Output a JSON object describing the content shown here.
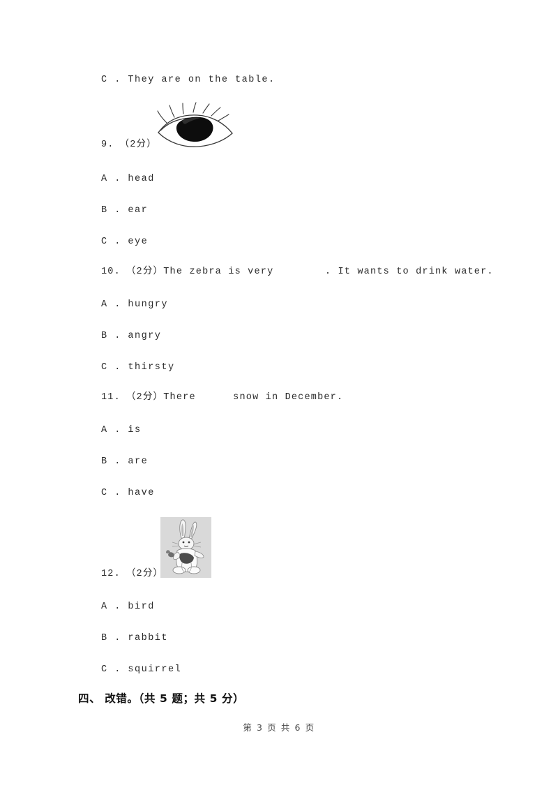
{
  "page": {
    "footer_text": "第 3 页 共 6 页",
    "page_number": 3,
    "total_pages": 6,
    "background_color": "#ffffff",
    "text_color": "#2a2a2a"
  },
  "content": {
    "carryover_option": "C . They are on the table.",
    "questions": [
      {
        "number": "9.",
        "marks": "（2分）",
        "prompt": "9.　（2分）",
        "figure": "eye-illustration",
        "options": [
          "A . head",
          "B . ear",
          "C . eye"
        ]
      },
      {
        "number": "10.",
        "marks": "（2分）",
        "prompt": "10.　（2分）The zebra is very　　　　　. It wants to drink water.",
        "options": [
          "A . hungry",
          "B . angry",
          "C . thirsty"
        ]
      },
      {
        "number": "11.",
        "marks": "（2分）",
        "prompt": "11.　（2分）There　　　 snow in December.",
        "options": [
          "A . is",
          "B . are",
          "C . have"
        ]
      },
      {
        "number": "12.",
        "marks": "（2分）",
        "prompt": "12.　（2分）",
        "figure": "rabbit-illustration",
        "options": [
          "A . bird",
          "B . rabbit",
          "C . squirrel"
        ]
      }
    ],
    "section_heading": "四、 改错。（共 5 题；共 5 分）"
  },
  "figures": {
    "eye": {
      "name": "eye-illustration",
      "description": "line drawing of an eye with lashes",
      "stroke_color": "#3a3a3a",
      "pupil_color": "#0d0d0d"
    },
    "rabbit": {
      "name": "rabbit-illustration",
      "description": "grayscale cartoon rabbit holding a carrot",
      "background_color": "#d9d9d9",
      "body_color": "#f2f2f2",
      "shade_color": "#6e6e6e"
    }
  }
}
